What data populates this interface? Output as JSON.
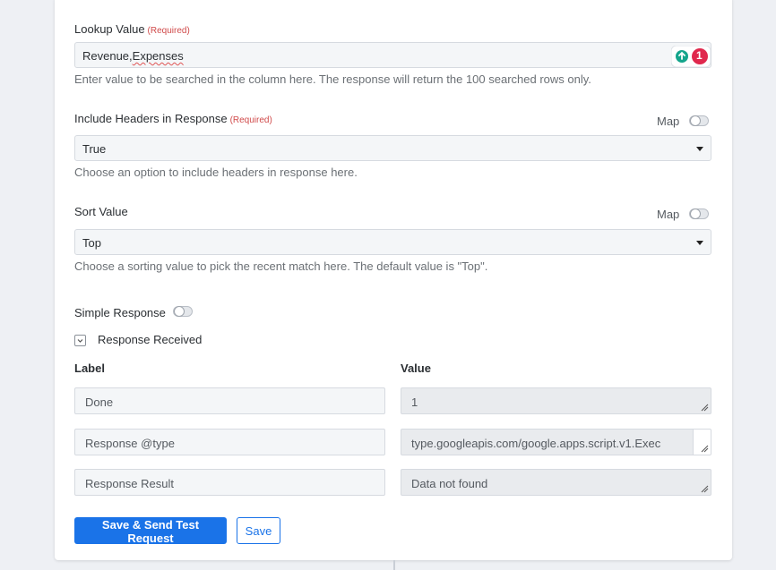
{
  "lookup": {
    "label": "Lookup Value",
    "required": "(Required)",
    "value_part1": "Revenue,",
    "value_part2": "Expenses",
    "help": "Enter value to be searched in the column here. The response will return the 100 searched rows only.",
    "badge_count": "1"
  },
  "headers": {
    "label": "Include Headers in Response",
    "required": "(Required)",
    "map_label": "Map",
    "value": "True",
    "help": "Choose an option to include headers in response here."
  },
  "sort": {
    "label": "Sort Value",
    "map_label": "Map",
    "value": "Top",
    "help": "Choose a sorting value to pick the recent match here. The default value is \"Top\"."
  },
  "simple_response": {
    "label": "Simple Response"
  },
  "response_received": {
    "label": "Response Received"
  },
  "table": {
    "col_label": "Label",
    "col_value": "Value",
    "rows": [
      {
        "label": "Done",
        "value": "1"
      },
      {
        "label": "Response @type",
        "value": "type.googleapis.com/google.apps.script.v1.Exec"
      },
      {
        "label": "Response Result",
        "value": "Data not found"
      }
    ]
  },
  "buttons": {
    "save_send": "Save & Send Test Request",
    "save": "Save"
  },
  "colors": {
    "primary": "#1a73e8",
    "required": "#d04a4a",
    "badge": "#e0284d",
    "grammar": "#15a58c"
  }
}
